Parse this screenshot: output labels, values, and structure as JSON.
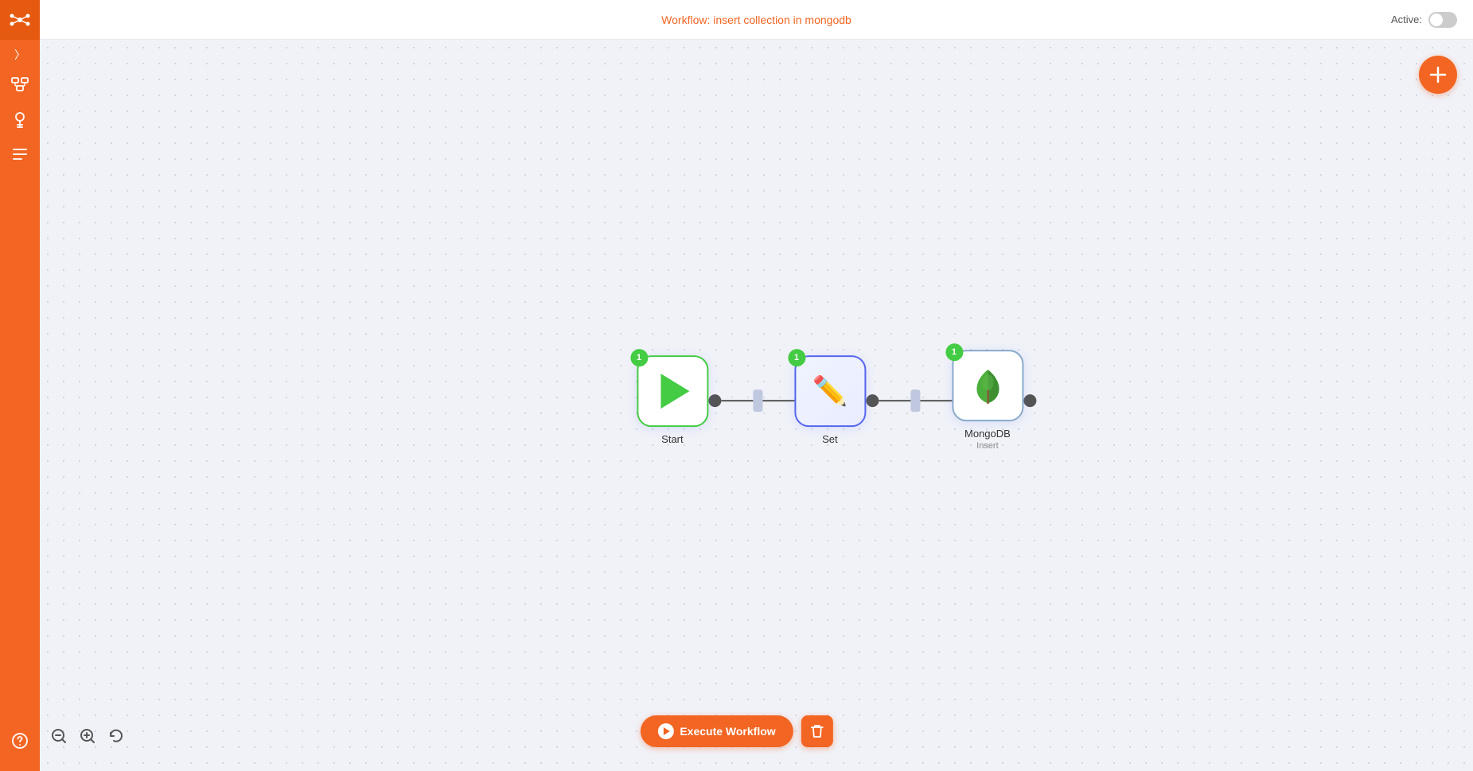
{
  "header": {
    "workflow_label": "Workflow:",
    "workflow_name": "insert collection in mongodb",
    "active_label": "Active:"
  },
  "sidebar": {
    "logo_icon": "share-icon",
    "arrow_icon": "chevron-right-icon",
    "workflow_icon": "workflow-icon",
    "key_icon": "key-icon",
    "list_icon": "list-icon",
    "help_icon": "help-icon"
  },
  "nodes": [
    {
      "id": "start",
      "label": "Start",
      "sublabel": "",
      "badge": "1",
      "type": "start"
    },
    {
      "id": "set",
      "label": "Set",
      "sublabel": "",
      "badge": "1",
      "type": "set"
    },
    {
      "id": "mongodb",
      "label": "MongoDB",
      "sublabel": "Insert",
      "badge": "1",
      "type": "mongodb"
    }
  ],
  "toolbar": {
    "execute_label": "Execute Workflow",
    "delete_label": "Delete"
  },
  "zoom": {
    "zoom_in_label": "Zoom In",
    "zoom_out_label": "Zoom Out",
    "reset_label": "Reset"
  },
  "fab": {
    "label": "Add Node"
  },
  "colors": {
    "brand": "#f26522",
    "sidebar": "#f26522",
    "node_border": "#a0b0ff",
    "start_border": "#44cc44",
    "badge_green": "#44cc44",
    "canvas_bg": "#f0f2f8"
  }
}
